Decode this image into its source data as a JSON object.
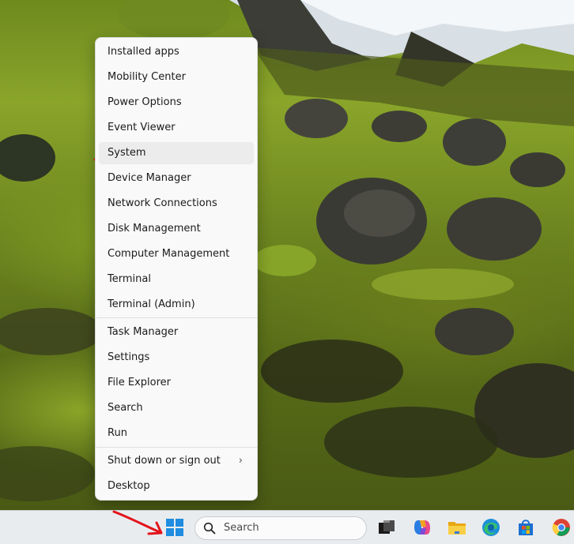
{
  "menu": {
    "groups": [
      {
        "items": [
          {
            "label": "Installed apps"
          },
          {
            "label": "Mobility Center"
          },
          {
            "label": "Power Options"
          },
          {
            "label": "Event Viewer"
          },
          {
            "label": "System"
          },
          {
            "label": "Device Manager"
          },
          {
            "label": "Network Connections"
          },
          {
            "label": "Disk Management"
          },
          {
            "label": "Computer Management"
          },
          {
            "label": "Terminal"
          },
          {
            "label": "Terminal (Admin)"
          }
        ]
      },
      {
        "items": [
          {
            "label": "Task Manager"
          },
          {
            "label": "Settings"
          },
          {
            "label": "File Explorer"
          },
          {
            "label": "Search"
          },
          {
            "label": "Run"
          }
        ]
      },
      {
        "items": [
          {
            "label": "Shut down or sign out",
            "submenu_indicator": "›"
          },
          {
            "label": "Desktop"
          }
        ]
      }
    ],
    "highlighted_item": "System",
    "annotation_color": "#e3131b"
  },
  "taskbar": {
    "search_placeholder": "Search",
    "start_icon": "windows-logo-icon",
    "pinned_icons": [
      "task-view-icon",
      "copilot-icon",
      "file-explorer-icon",
      "edge-icon",
      "microsoft-store-icon",
      "chrome-icon"
    ],
    "accent_color": "#1f8de0"
  }
}
